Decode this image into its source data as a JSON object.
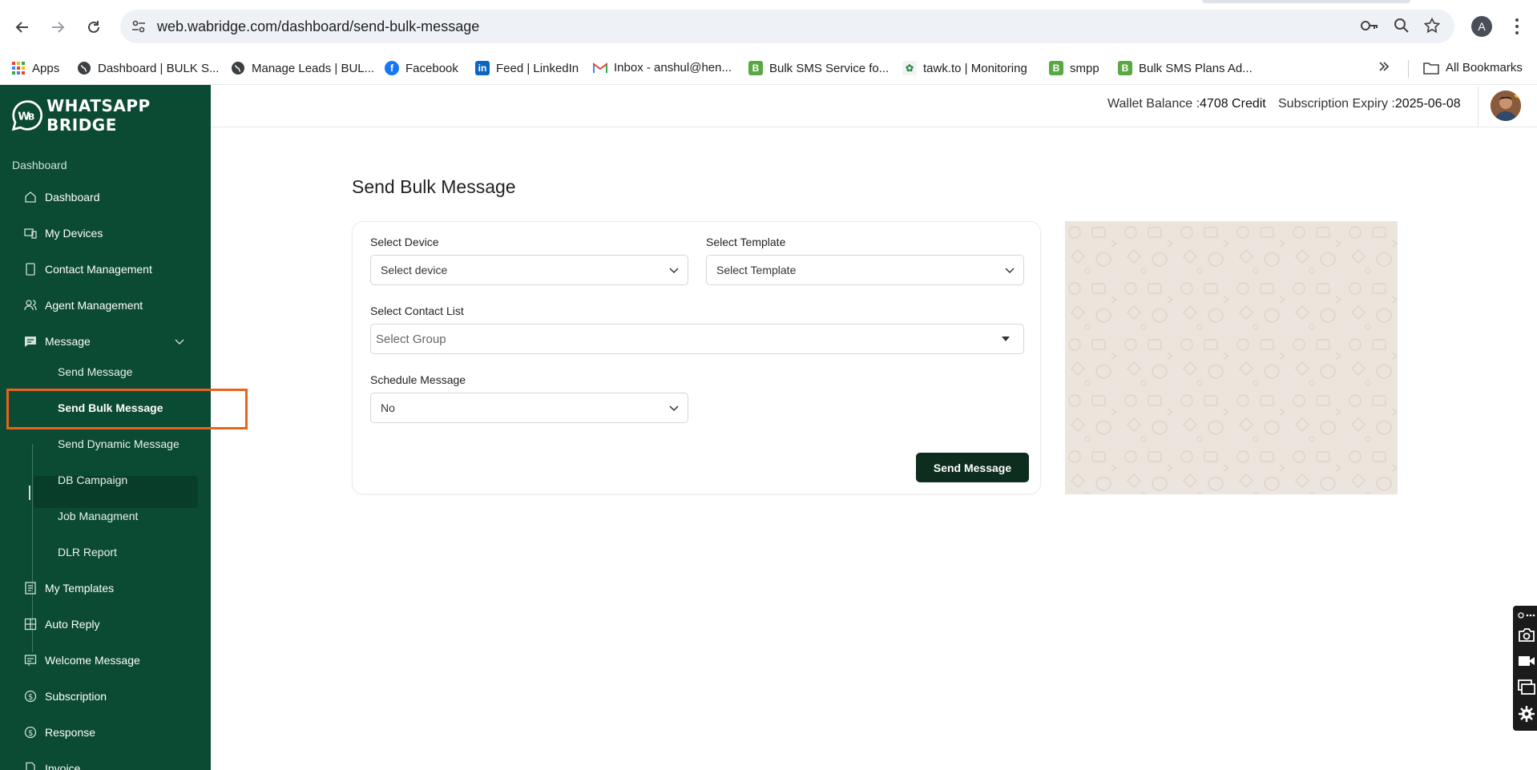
{
  "browser": {
    "url": "web.wabridge.com/dashboard/send-bulk-message",
    "profile_initial": "A",
    "bookmarks": [
      {
        "label": "Apps",
        "icon": "apps-grid-icon"
      },
      {
        "label": "Dashboard | BULK S...",
        "icon": "globe-icon"
      },
      {
        "label": "Manage Leads | BUL...",
        "icon": "globe-icon"
      },
      {
        "label": "Facebook",
        "icon": "facebook-icon"
      },
      {
        "label": "Feed | LinkedIn",
        "icon": "linkedin-icon"
      },
      {
        "label": "Inbox - anshul@hen...",
        "icon": "gmail-icon"
      },
      {
        "label": "Bulk SMS Service fo...",
        "icon": "bulksms-icon"
      },
      {
        "label": "tawk.to | Monitoring",
        "icon": "tawkto-icon"
      },
      {
        "label": "smpp",
        "icon": "bulksms-icon"
      },
      {
        "label": "Bulk SMS Plans Ad...",
        "icon": "bulksms-icon"
      }
    ],
    "all_bookmarks": "All Bookmarks"
  },
  "app": {
    "logo_text": "WHATSAPP BRIDGE",
    "sidebar": {
      "section": "Dashboard",
      "items": [
        {
          "label": "Dashboard",
          "icon": "home-icon"
        },
        {
          "label": "My Devices",
          "icon": "devices-icon"
        },
        {
          "label": "Contact Management",
          "icon": "tablet-icon"
        },
        {
          "label": "Agent Management",
          "icon": "users-icon"
        },
        {
          "label": "Message",
          "icon": "message-icon"
        }
      ],
      "sub_items": [
        "Send Message",
        "Send Bulk Message",
        "Send Dynamic Message",
        "DB Campaign",
        "Job Managment",
        "DLR Report"
      ],
      "items_after": [
        {
          "label": "My Templates",
          "icon": "template-icon"
        },
        {
          "label": "Auto Reply",
          "icon": "grid-icon"
        },
        {
          "label": "Welcome Message",
          "icon": "welcome-icon"
        },
        {
          "label": "Subscription",
          "icon": "dollar-icon"
        },
        {
          "label": "Response",
          "icon": "dollar-icon"
        },
        {
          "label": "Invoice",
          "icon": "invoice-icon"
        }
      ]
    },
    "topbar": {
      "wallet_label": "Wallet Balance :",
      "wallet_value": "4708 Credit",
      "expiry_label": "Subscription Expiry :",
      "expiry_value": "2025-06-08"
    },
    "page_title": "Send Bulk Message",
    "form": {
      "device_label": "Select Device",
      "device_value": "Select device",
      "template_label": "Select Template",
      "template_value": "Select Template",
      "contact_label": "Select Contact List",
      "contact_value": "Select Group",
      "schedule_label": "Schedule Message",
      "schedule_value": "No",
      "submit": "Send Message"
    },
    "colors": {
      "sidebar": "#0b4a33",
      "button": "#0d2d1f",
      "highlight": "#e8641e",
      "preview_bg": "#ece5dd"
    }
  }
}
